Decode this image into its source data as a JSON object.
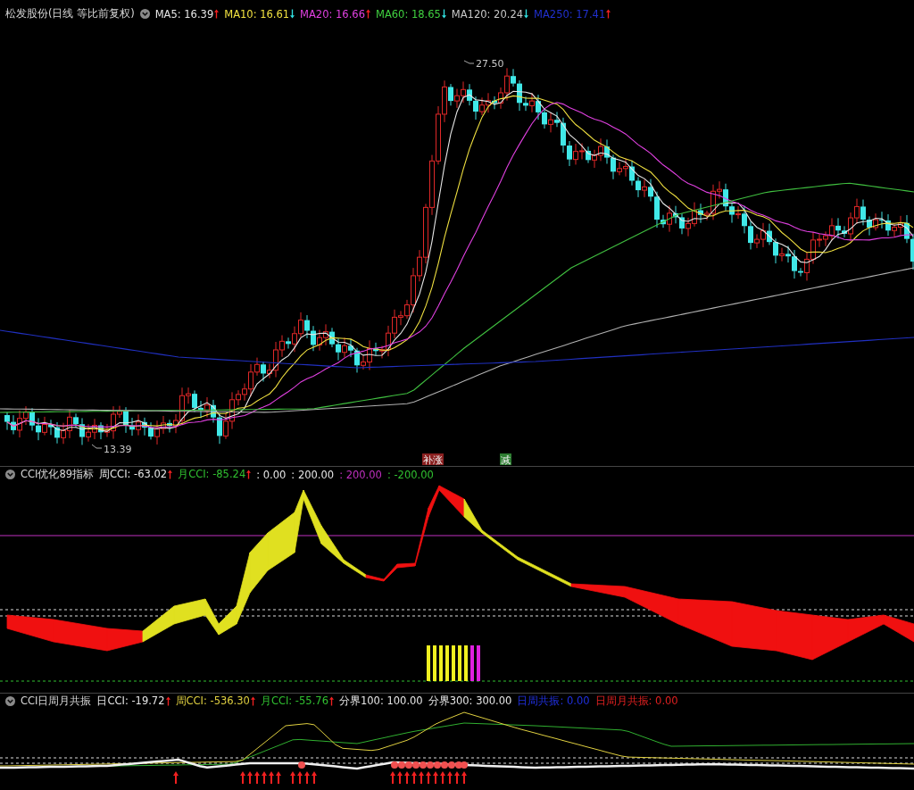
{
  "main_panel": {
    "title": "松发股份(日线 等比前复权)",
    "indicators": [
      {
        "label": "MA5: 16.39",
        "color": "#e6e6e6",
        "rising": true
      },
      {
        "label": "MA10: 16.61",
        "color": "#f0e040",
        "rising": false
      },
      {
        "label": "MA20: 16.66",
        "color": "#e040e0",
        "rising": true
      },
      {
        "label": "MA60: 18.65",
        "color": "#40d040",
        "rising": false
      },
      {
        "label": "MA120: 20.24",
        "color": "#c8c8c8",
        "rising": false
      },
      {
        "label": "MA250: 17.41",
        "color": "#2030d0",
        "rising": true
      }
    ],
    "high_label": "27.50",
    "low_label": "13.39",
    "signals": [
      {
        "text": "补涨",
        "color": "#8a2020"
      },
      {
        "text": "减",
        "color": "#2e7d32"
      }
    ]
  },
  "cci_panel": {
    "title": "CCI优化89指标",
    "values": [
      {
        "label": "周CCI: -63.02",
        "color": "#e6e6e6",
        "rising": true
      },
      {
        "label": "月CCI: -85.24",
        "color": "#30c030",
        "rising": true
      },
      {
        "label": ": 0.00",
        "color": "#e6e6e6"
      },
      {
        "label": ": 200.00",
        "color": "#e6e6e6"
      },
      {
        "label": ": 200.00",
        "color": "#c030c0"
      },
      {
        "label": ": -200.00",
        "color": "#30c030"
      }
    ]
  },
  "resonance_panel": {
    "title": "CCI日周月共振",
    "values": [
      {
        "label": "日CCI: -19.72",
        "color": "#e6e6e6",
        "rising": true
      },
      {
        "label": "周CCI: -536.30",
        "color": "#e0d040",
        "rising": true
      },
      {
        "label": "月CCI: -55.76",
        "color": "#30c030",
        "rising": true
      },
      {
        "label": "分界100: 100.00",
        "color": "#e6e6e6"
      },
      {
        "label": "分界300: 300.00",
        "color": "#e6e6e6"
      },
      {
        "label": "日周共振: 0.00",
        "color": "#2030e0"
      },
      {
        "label": "日周月共振: 0.00",
        "color": "#e02020"
      }
    ]
  }
}
